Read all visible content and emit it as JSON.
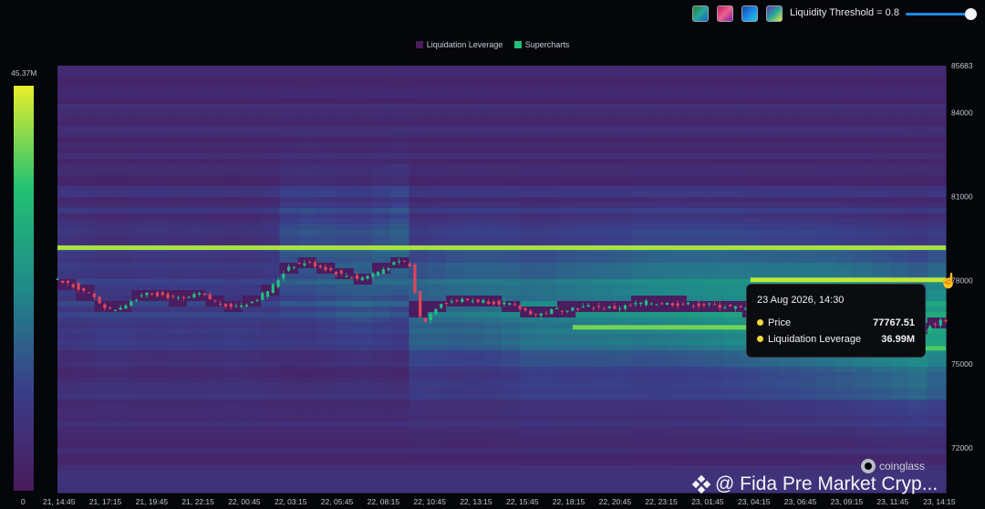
{
  "controls": {
    "threshold_label": "Liquidity Threshold = 0.8",
    "threshold_value": 0.8,
    "swatches": [
      "palette-green",
      "palette-pink",
      "palette-blue",
      "palette-viridis"
    ]
  },
  "legend": [
    {
      "label": "Liquidation Leverage",
      "color": "#4a1a5c"
    },
    {
      "label": "Supercharts",
      "color": "#1fbf7a"
    }
  ],
  "colorbar": {
    "max_label": "45.37M",
    "min_label": "0"
  },
  "tooltip": {
    "date": "23 Aug 2026, 14:30",
    "rows": [
      {
        "label": "Price",
        "value": "77767.51"
      },
      {
        "label": "Liquidation Leverage",
        "value": "36.99M"
      }
    ]
  },
  "watermark": {
    "brand": "coinglass",
    "text": "@ Fida Pre Market Cryp..."
  },
  "chart_data": {
    "type": "heatmap",
    "x_ticks": [
      "21, 14:45",
      "21, 17:15",
      "21, 19:45",
      "21, 22:15",
      "22, 00:45",
      "22, 03:15",
      "22, 05:45",
      "22, 08:15",
      "22, 10:45",
      "22, 13:15",
      "22, 15:45",
      "22, 18:15",
      "22, 20:45",
      "22, 23:15",
      "23, 01:45",
      "23, 04:15",
      "23, 06:45",
      "23, 09:15",
      "23, 11:45",
      "23, 14:15"
    ],
    "y_ticks": [
      "85683",
      "84000",
      "81000",
      "78000",
      "75000",
      "72000"
    ],
    "y_tick_values": [
      85683,
      84000,
      81000,
      78000,
      75000,
      72000
    ],
    "ylim": [
      70400,
      85683
    ],
    "colorbar_range": [
      0,
      45.37
    ],
    "liquidity_bands": [
      {
        "price": 79150,
        "t_start": 0.0,
        "t_end": 1.0,
        "intensity": 0.92
      },
      {
        "price": 78000,
        "t_start": 0.78,
        "t_end": 1.0,
        "intensity": 0.95
      },
      {
        "price": 76300,
        "t_start": 0.58,
        "t_end": 0.82,
        "intensity": 0.85
      },
      {
        "price": 75550,
        "t_start": 0.96,
        "t_end": 1.0,
        "intensity": 0.8
      }
    ],
    "price_series": [
      {
        "t": 0.0,
        "p": 78000
      },
      {
        "t": 0.02,
        "p": 77800
      },
      {
        "t": 0.04,
        "p": 77400
      },
      {
        "t": 0.06,
        "p": 76900
      },
      {
        "t": 0.08,
        "p": 77200
      },
      {
        "t": 0.1,
        "p": 77600
      },
      {
        "t": 0.12,
        "p": 77450
      },
      {
        "t": 0.14,
        "p": 77300
      },
      {
        "t": 0.16,
        "p": 77500
      },
      {
        "t": 0.18,
        "p": 77200
      },
      {
        "t": 0.2,
        "p": 77050
      },
      {
        "t": 0.22,
        "p": 77250
      },
      {
        "t": 0.24,
        "p": 77700
      },
      {
        "t": 0.26,
        "p": 78500
      },
      {
        "t": 0.28,
        "p": 78650
      },
      {
        "t": 0.3,
        "p": 78450
      },
      {
        "t": 0.32,
        "p": 78200
      },
      {
        "t": 0.34,
        "p": 78050
      },
      {
        "t": 0.36,
        "p": 78300
      },
      {
        "t": 0.38,
        "p": 78600
      },
      {
        "t": 0.395,
        "p": 78700
      },
      {
        "t": 0.41,
        "p": 76400
      },
      {
        "t": 0.43,
        "p": 77200
      },
      {
        "t": 0.46,
        "p": 77300
      },
      {
        "t": 0.5,
        "p": 77200
      },
      {
        "t": 0.52,
        "p": 77000
      },
      {
        "t": 0.54,
        "p": 76750
      },
      {
        "t": 0.56,
        "p": 76950
      },
      {
        "t": 0.6,
        "p": 77050
      },
      {
        "t": 0.63,
        "p": 77000
      },
      {
        "t": 0.66,
        "p": 77200
      },
      {
        "t": 0.7,
        "p": 77150
      },
      {
        "t": 0.74,
        "p": 77100
      },
      {
        "t": 0.77,
        "p": 77000
      },
      {
        "t": 0.8,
        "p": 76900
      },
      {
        "t": 0.85,
        "p": 76800
      },
      {
        "t": 0.9,
        "p": 76600
      },
      {
        "t": 0.94,
        "p": 76400
      },
      {
        "t": 0.97,
        "p": 76200
      },
      {
        "t": 1.0,
        "p": 76600
      }
    ]
  }
}
